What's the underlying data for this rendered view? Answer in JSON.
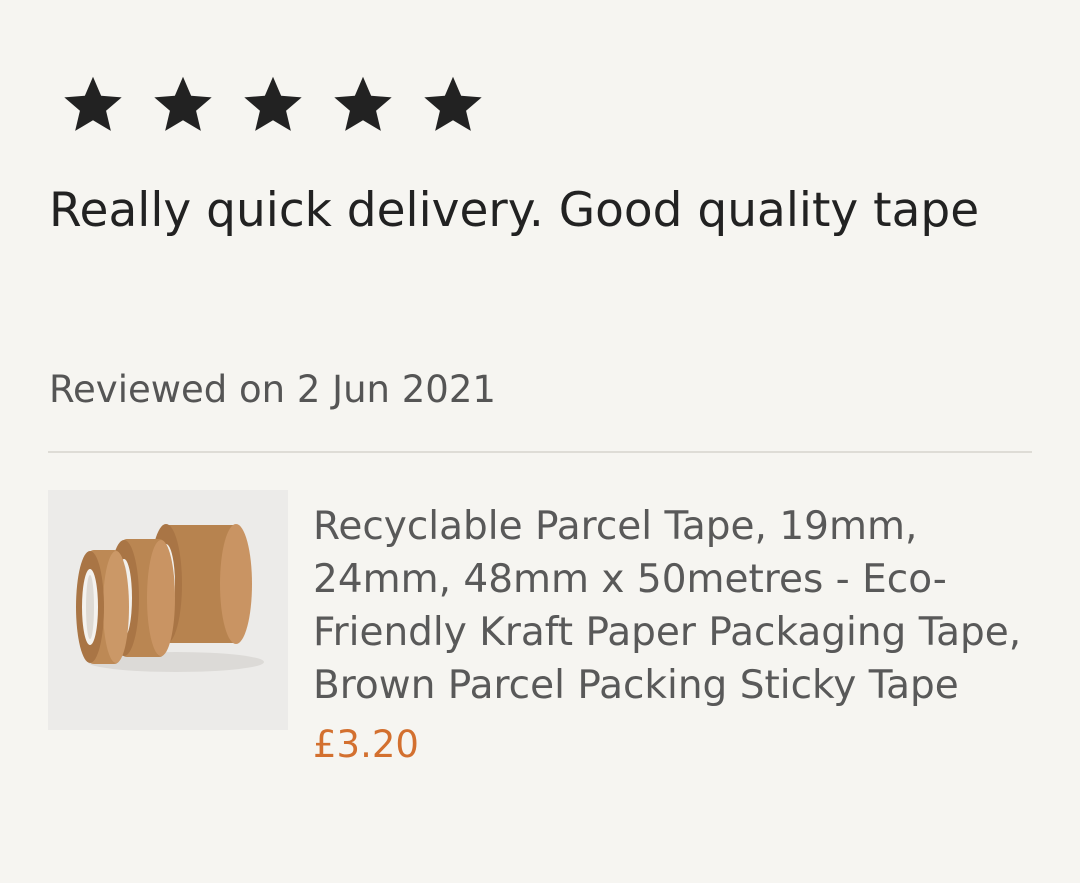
{
  "review": {
    "rating": 5,
    "rating_max": 5,
    "text": "Really quick delivery. Good quality tape",
    "date_line": "Reviewed on 2 Jun 2021"
  },
  "product": {
    "image_icon": "tape-rolls-image",
    "title": "Recyclable Parcel Tape, 19mm, 24mm, 48mm x 50metres - Eco-Friendly Kraft Paper Packaging Tape, Brown Parcel Packing Sticky Tape",
    "price": "£3.20"
  },
  "colors": {
    "background": "#f6f5f1",
    "star": "#222222",
    "price": "#d3702f",
    "divider": "#dedcd6"
  }
}
